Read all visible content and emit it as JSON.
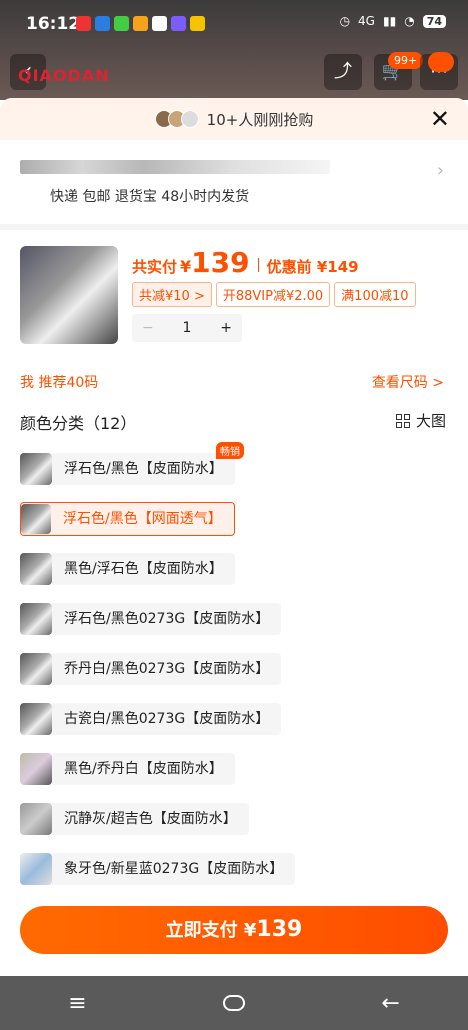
{
  "status_bar": {
    "time": "16:12",
    "signal": "4G",
    "battery": "74"
  },
  "header": {
    "brand": "QIAODAN",
    "cart_badge": "99+"
  },
  "banner": {
    "text": "10+人刚刚抢购"
  },
  "address": {
    "line": "快递 包邮 退货宝 48小时内发货"
  },
  "pricing": {
    "label": "共实付",
    "currency": "¥",
    "amount": "139",
    "before_label": "优惠前 ¥149",
    "tags": [
      "共减¥10 >",
      "开88VIP减¥2.00",
      "满100减10"
    ],
    "quantity": "1",
    "minus": "−",
    "plus": "+"
  },
  "recommend": {
    "text": "我 推荐40码",
    "size_link": "查看尺码 >"
  },
  "color_section": {
    "title": "颜色分类（12）",
    "big_view": "大图",
    "hot_badge": "畅销"
  },
  "options": [
    {
      "label": "浮石色/黑色【皮面防水】"
    },
    {
      "label": "浮石色/黑色【网面透气】"
    },
    {
      "label": "黑色/浮石色【皮面防水】"
    },
    {
      "label": "浮石色/黑色0273G【皮面防水】"
    },
    {
      "label": "乔丹白/黑色0273G【皮面防水】"
    },
    {
      "label": "古瓷白/黑色0273G【皮面防水】"
    },
    {
      "label": "黑色/乔丹白【皮面防水】"
    },
    {
      "label": "沉静灰/超吉色【皮面防水】"
    },
    {
      "label": "象牙色/新星蓝0273G【皮面防水】"
    }
  ],
  "pay_button": {
    "label": "立即支付 ¥",
    "amount": "139"
  },
  "nav": {
    "menu": "≡",
    "back": "←"
  },
  "colors": {
    "accent": "#ff5000",
    "accent_light": "#fff1ea",
    "banner_bg": "#fff3ec"
  }
}
